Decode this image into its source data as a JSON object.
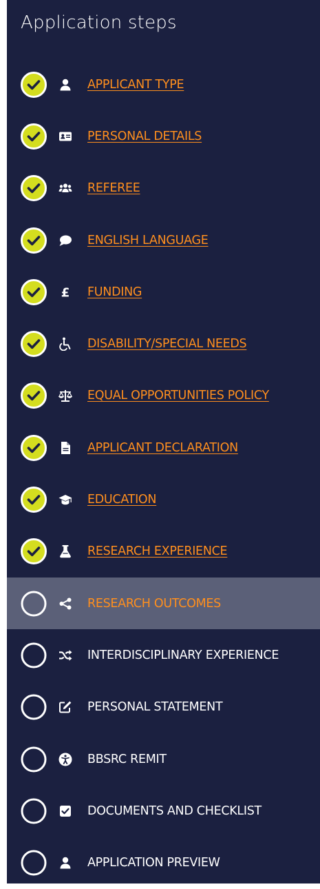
{
  "title": "Application steps",
  "colors": {
    "panel": "#1b2040",
    "active_row": "#5b6078",
    "link": "#ff8f1e",
    "check": "#d4dd1f"
  },
  "steps": [
    {
      "label": "APPLICANT TYPE",
      "icon": "user-icon",
      "status": "complete"
    },
    {
      "label": "PERSONAL DETAILS",
      "icon": "id-card-icon",
      "status": "complete"
    },
    {
      "label": "REFEREE",
      "icon": "users-icon",
      "status": "complete"
    },
    {
      "label": "ENGLISH LANGUAGE",
      "icon": "speech-bubble-icon",
      "status": "complete"
    },
    {
      "label": "FUNDING",
      "icon": "pound-sign-icon",
      "status": "complete"
    },
    {
      "label": "DISABILITY/SPECIAL NEEDS",
      "icon": "wheelchair-icon",
      "status": "complete"
    },
    {
      "label": "EQUAL OPPORTUNITIES POLICY",
      "icon": "scales-icon",
      "status": "complete"
    },
    {
      "label": "APPLICANT DECLARATION",
      "icon": "document-icon",
      "status": "complete"
    },
    {
      "label": "EDUCATION",
      "icon": "graduation-cap-icon",
      "status": "complete"
    },
    {
      "label": "RESEARCH EXPERIENCE",
      "icon": "flask-icon",
      "status": "complete"
    },
    {
      "label": "RESEARCH OUTCOMES",
      "icon": "share-nodes-icon",
      "status": "current"
    },
    {
      "label": "INTERDISCIPLINARY EXPERIENCE",
      "icon": "shuffle-icon",
      "status": "incomplete"
    },
    {
      "label": "PERSONAL STATEMENT",
      "icon": "edit-icon",
      "status": "incomplete"
    },
    {
      "label": "BBSRC REMIT",
      "icon": "accessibility-icon",
      "status": "incomplete"
    },
    {
      "label": "DOCUMENTS AND CHECKLIST",
      "icon": "checkbox-icon",
      "status": "incomplete"
    },
    {
      "label": "APPLICATION PREVIEW",
      "icon": "user-icon",
      "status": "incomplete"
    }
  ]
}
